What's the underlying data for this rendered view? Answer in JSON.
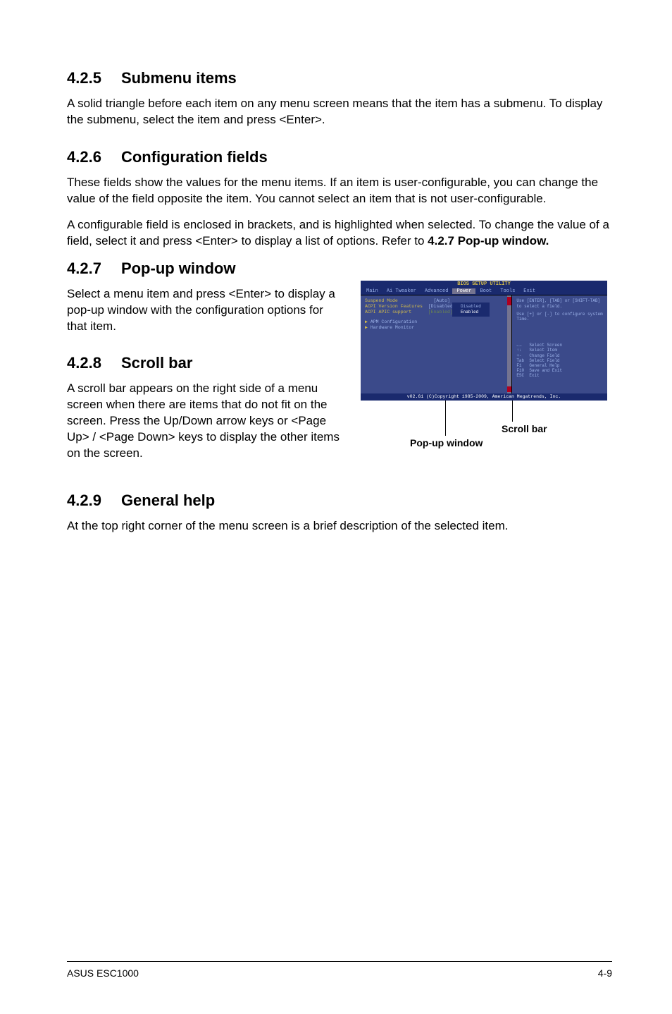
{
  "sections": {
    "s425": {
      "num": "4.2.5",
      "title": "Submenu items",
      "body1": "A solid triangle before each item on any menu screen means that the item has a submenu. To display the submenu, select the item and press <Enter>."
    },
    "s426": {
      "num": "4.2.6",
      "title": "Configuration fields",
      "body1": "These fields show the values for the menu items. If an item is user-configurable, you can change the value of the field opposite the item. You cannot select an item that is not user-configurable.",
      "body2": "A configurable field is enclosed in brackets, and is highlighted when selected. To change the value of a field, select it and press <Enter> to display a list of options. Refer to 4.2.7 Pop-up window."
    },
    "s427": {
      "num": "4.2.7",
      "title": "Pop-up window",
      "body1": "Select a menu item and press <Enter> to display a pop-up window with the configuration options for that item."
    },
    "s428": {
      "num": "4.2.8",
      "title": "Scroll bar",
      "body1": "A scroll bar appears on the right side of a menu screen when there are items that do not fit on the screen. Press the Up/Down arrow keys or <Page Up> / <Page Down> keys to display the other items on the screen."
    },
    "s429": {
      "num": "4.2.9",
      "title": "General help",
      "body1": "At the top right corner of the menu screen is a brief description of the selected item."
    }
  },
  "bios": {
    "title": "BIOS SETUP UTILITY",
    "tabs": [
      "Main",
      "Ai Tweaker",
      "Advanced",
      "Power",
      "Boot",
      "Tools",
      "Exit"
    ],
    "items": [
      {
        "label": "Suspend Mode",
        "value": "[Auto]"
      },
      {
        "label": "ACPI Version Features",
        "value": "[Disabled]"
      },
      {
        "label": "ACPI APIC support",
        "value": "[Enabled]"
      }
    ],
    "subs": [
      "APM Configuration",
      "Hardware Monitor"
    ],
    "popup": [
      "Disabled",
      "Enabled"
    ],
    "help1": "Use [ENTER], [TAB] or [SHIFT-TAB] to select a field.",
    "help2": "Use [+] or [-] to configure system Time.",
    "keys": [
      {
        "k": "←→",
        "d": "Select Screen"
      },
      {
        "k": "↑↓",
        "d": "Select Item"
      },
      {
        "k": "+-",
        "d": "Change Field"
      },
      {
        "k": "Tab",
        "d": "Select Field"
      },
      {
        "k": "F1",
        "d": "General Help"
      },
      {
        "k": "F10",
        "d": "Save and Exit"
      },
      {
        "k": "ESC",
        "d": "Exit"
      }
    ],
    "footer": "v02.61 (C)Copyright 1985-2009, American Megatrends, Inc."
  },
  "callouts": {
    "scroll": "Scroll bar",
    "popup": "Pop-up window"
  },
  "footer": {
    "left": "ASUS ESC1000",
    "right": "4-9"
  }
}
